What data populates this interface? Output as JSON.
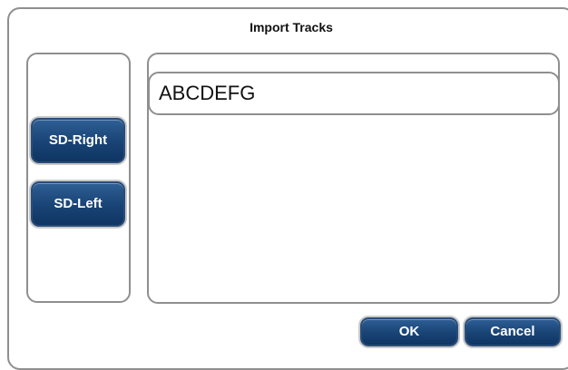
{
  "dialog": {
    "title": "Import Tracks"
  },
  "sources": [
    {
      "label": "SD-Right"
    },
    {
      "label": "SD-Left"
    }
  ],
  "files": [
    {
      "name": "ABCDEFG"
    }
  ],
  "actions": {
    "ok_label": "OK",
    "cancel_label": "Cancel"
  }
}
